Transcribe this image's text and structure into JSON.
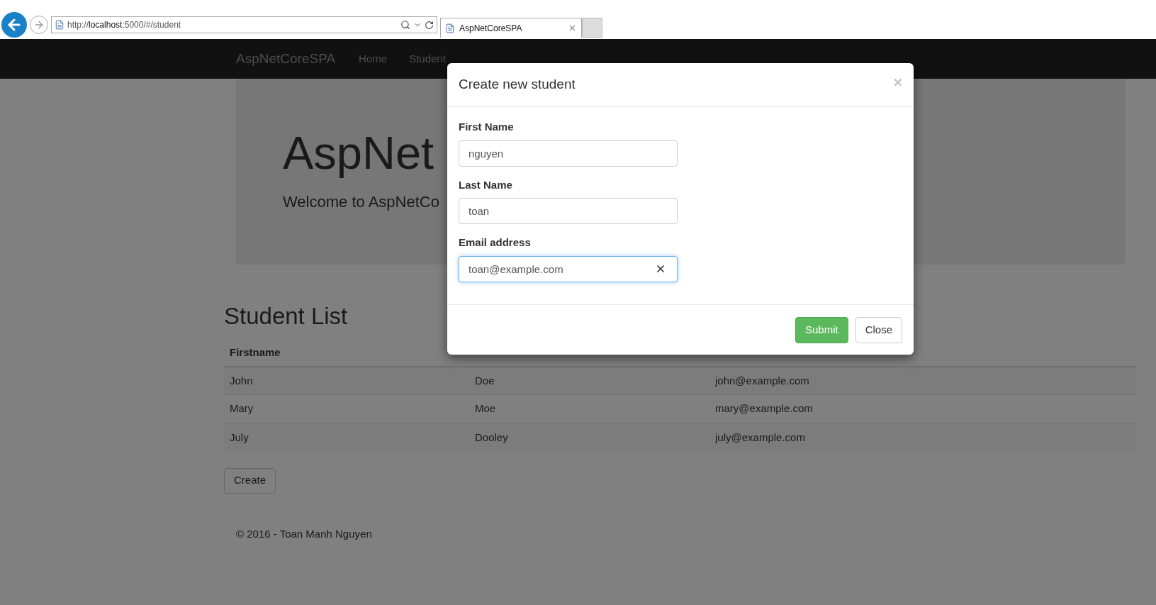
{
  "browser": {
    "url_prefix": "http://",
    "url_host": "localhost",
    "url_rest": ":5000/#/student",
    "tab_title": "AspNetCoreSPA"
  },
  "navbar": {
    "brand": "AspNetCoreSPA",
    "links": [
      "Home",
      "Student"
    ]
  },
  "jumbotron": {
    "heading": "AspNet",
    "subtitle": "Welcome to AspNetCo"
  },
  "student_list": {
    "title": "Student List",
    "columns": [
      "Firstname"
    ],
    "rows": [
      [
        "John",
        "Doe",
        "john@example.com"
      ],
      [
        "Mary",
        "Moe",
        "mary@example.com"
      ],
      [
        "July",
        "Dooley",
        "july@example.com"
      ]
    ],
    "create_button": "Create"
  },
  "footer": "© 2016 - Toan Manh Nguyen",
  "modal": {
    "title": "Create new student",
    "close_icon": "×",
    "fields": [
      {
        "label": "First Name",
        "value": "nguyen",
        "focused": false
      },
      {
        "label": "Last Name",
        "value": "toan",
        "focused": false
      },
      {
        "label": "Email address",
        "value": "toan@example.com",
        "focused": true
      }
    ],
    "buttons": [
      {
        "label": "Submit",
        "kind": "primary"
      },
      {
        "label": "Close",
        "kind": "default"
      }
    ]
  }
}
